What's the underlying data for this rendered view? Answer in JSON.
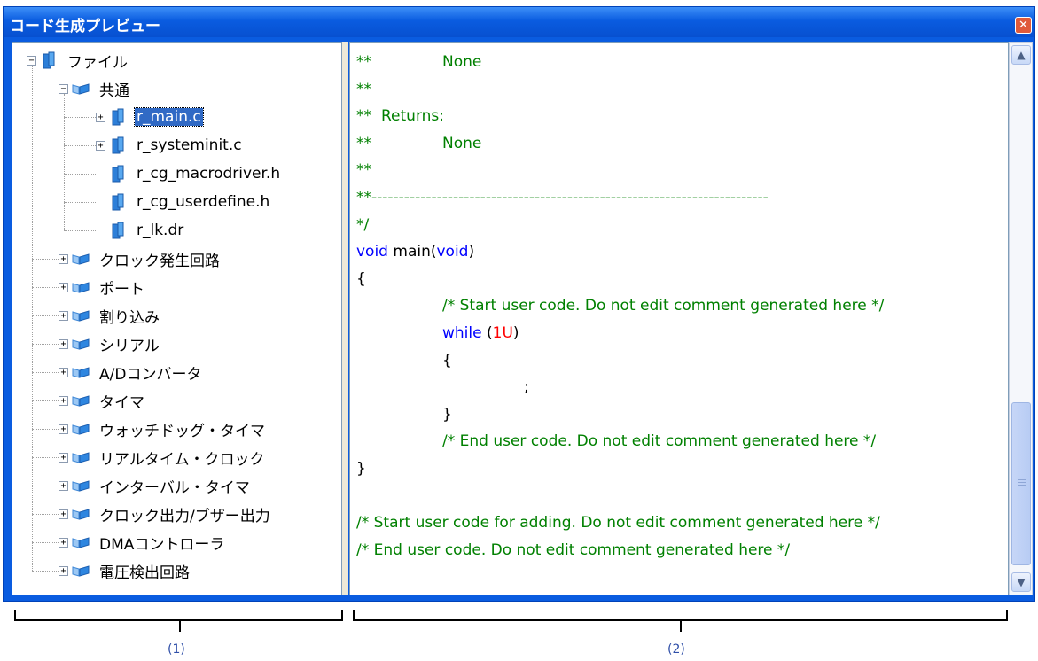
{
  "window": {
    "title": "コード生成プレビュー",
    "close_glyph": "✕"
  },
  "tree": {
    "root": {
      "label": "ファイル",
      "expander": "−"
    },
    "common": {
      "label": "共通",
      "expander": "−"
    },
    "files": [
      {
        "label": "r_main.c",
        "expander": "+",
        "selected": true
      },
      {
        "label": "r_systeminit.c",
        "expander": "+"
      },
      {
        "label": "r_cg_macrodriver.h",
        "expander": ""
      },
      {
        "label": "r_cg_userdefine.h",
        "expander": ""
      },
      {
        "label": "r_lk.dr",
        "expander": ""
      }
    ],
    "folders": [
      {
        "label": "クロック発生回路",
        "expander": "+"
      },
      {
        "label": "ポート",
        "expander": "+"
      },
      {
        "label": "割り込み",
        "expander": "+"
      },
      {
        "label": "シリアル",
        "expander": "+"
      },
      {
        "label": "A/Dコンバータ",
        "expander": "+"
      },
      {
        "label": "タイマ",
        "expander": "+"
      },
      {
        "label": "ウォッチドッグ・タイマ",
        "expander": "+"
      },
      {
        "label": "リアルタイム・クロック",
        "expander": "+"
      },
      {
        "label": "インターバル・タイマ",
        "expander": "+"
      },
      {
        "label": "クロック出力/ブザー出力",
        "expander": "+"
      },
      {
        "label": "DMAコントローラ",
        "expander": "+"
      },
      {
        "label": "電圧検出回路",
        "expander": "+"
      }
    ]
  },
  "code": {
    "lines": [
      {
        "a": "**",
        "b": "None"
      },
      {
        "a": "**"
      },
      {
        "a": "**",
        "b": "Returns:"
      },
      {
        "a": "**",
        "b": "None"
      },
      {
        "a": "**"
      },
      {
        "a": "**-------------------------------------------------------------------------"
      },
      {
        "a": "*/"
      },
      {
        "kw": "void",
        "mid": " main(",
        "kw2": "void",
        "end": ")"
      },
      {
        "a": "{"
      },
      {
        "comment": "/* Start user code. Do not edit comment generated here */"
      },
      {
        "kw": "while",
        "mid": " (",
        "num": "1U",
        "end": ")"
      },
      {
        "a": "{"
      },
      {
        "a": ";"
      },
      {
        "a": "}"
      },
      {
        "comment": "/* End user code. Do not edit comment generated here */"
      },
      {
        "a": "}"
      },
      {
        "a": ""
      },
      {
        "comment": "/* Start user code for adding. Do not edit comment generated here */"
      },
      {
        "comment": "/* End user code. Do not edit comment generated here */"
      }
    ]
  },
  "scrollbar": {
    "up_glyph": "▲",
    "down_glyph": "▼",
    "position": 0.85
  },
  "annotations": {
    "caption_1": "(1)",
    "caption_2": "(2)"
  },
  "colors": {
    "titlebar": "#0a5ce0",
    "selection": "#316ac5",
    "comment": "#008000",
    "keyword": "#0000ff",
    "number": "#ff0000",
    "caption": "#2f4fa8"
  }
}
